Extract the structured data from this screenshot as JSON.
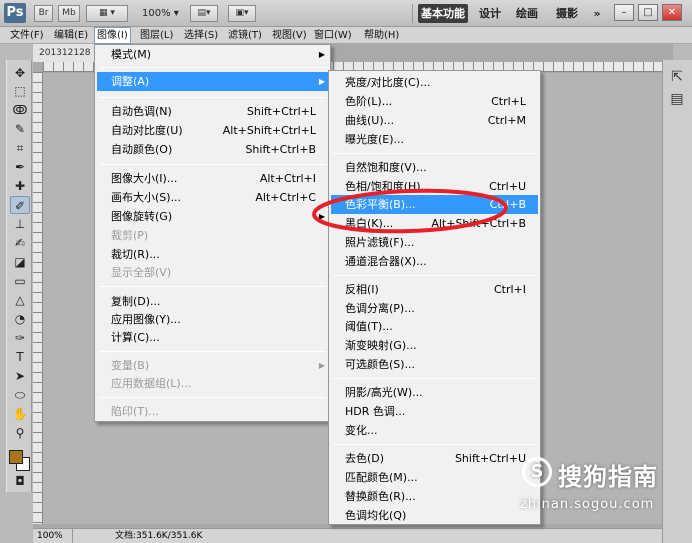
{
  "titlebar": {
    "logo": "Ps",
    "btn_br": "Br",
    "btn_mb": "Mb",
    "zoom": "100%",
    "workspaces": [
      "基本功能",
      "设计",
      "绘画",
      "摄影"
    ],
    "more": "»"
  },
  "menubar": [
    "文件(F)",
    "编辑(E)",
    "图像(I)",
    "图层(L)",
    "选择(S)",
    "滤镜(T)",
    "视图(V)",
    "窗口(W)",
    "帮助(H)"
  ],
  "document": {
    "tab": "201312128"
  },
  "image_menu": [
    {
      "label": "模式(M)",
      "shortcut": "",
      "arrow": "▶",
      "disabled": false
    },
    {
      "label": "调整(A)",
      "shortcut": "",
      "arrow": "▶",
      "disabled": false
    },
    {
      "label": "自动色调(N)",
      "shortcut": "Shift+Ctrl+L",
      "disabled": false
    },
    {
      "label": "自动对比度(U)",
      "shortcut": "Alt+Shift+Ctrl+L",
      "disabled": false
    },
    {
      "label": "自动颜色(O)",
      "shortcut": "Shift+Ctrl+B",
      "disabled": false
    },
    {
      "label": "图像大小(I)...",
      "shortcut": "Alt+Ctrl+I",
      "disabled": false
    },
    {
      "label": "画布大小(S)...",
      "shortcut": "Alt+Ctrl+C",
      "disabled": false
    },
    {
      "label": "图像旋转(G)",
      "shortcut": "",
      "arrow": "▶",
      "disabled": false
    },
    {
      "label": "裁剪(P)",
      "shortcut": "",
      "disabled": true
    },
    {
      "label": "裁切(R)...",
      "shortcut": "",
      "disabled": false
    },
    {
      "label": "显示全部(V)",
      "shortcut": "",
      "disabled": true
    },
    {
      "label": "复制(D)...",
      "shortcut": "",
      "disabled": false
    },
    {
      "label": "应用图像(Y)...",
      "shortcut": "",
      "disabled": false
    },
    {
      "label": "计算(C)...",
      "shortcut": "",
      "disabled": false
    },
    {
      "label": "变量(B)",
      "shortcut": "",
      "arrow": "▶",
      "disabled": true
    },
    {
      "label": "应用数据组(L)...",
      "shortcut": "",
      "disabled": true
    },
    {
      "label": "陷印(T)...",
      "shortcut": "",
      "disabled": true
    }
  ],
  "adjust_menu": [
    {
      "label": "亮度/对比度(C)...",
      "shortcut": ""
    },
    {
      "label": "色阶(L)...",
      "shortcut": "Ctrl+L"
    },
    {
      "label": "曲线(U)...",
      "shortcut": "Ctrl+M"
    },
    {
      "label": "曝光度(E)...",
      "shortcut": ""
    },
    {
      "label": "自然饱和度(V)...",
      "shortcut": ""
    },
    {
      "label": "色相/饱和度(H)...",
      "shortcut": "Ctrl+U"
    },
    {
      "label": "色彩平衡(B)...",
      "shortcut": "Ctrl+B"
    },
    {
      "label": "黑白(K)...",
      "shortcut": "Alt+Shift+Ctrl+B"
    },
    {
      "label": "照片滤镜(F)...",
      "shortcut": ""
    },
    {
      "label": "通道混合器(X)...",
      "shortcut": ""
    },
    {
      "label": "反相(I)",
      "shortcut": "Ctrl+I"
    },
    {
      "label": "色调分离(P)...",
      "shortcut": ""
    },
    {
      "label": "阈值(T)...",
      "shortcut": ""
    },
    {
      "label": "渐变映射(G)...",
      "shortcut": ""
    },
    {
      "label": "可选颜色(S)...",
      "shortcut": ""
    },
    {
      "label": "阴影/高光(W)...",
      "shortcut": ""
    },
    {
      "label": "HDR 色调...",
      "shortcut": ""
    },
    {
      "label": "变化...",
      "shortcut": ""
    },
    {
      "label": "去色(D)",
      "shortcut": "Shift+Ctrl+U"
    },
    {
      "label": "匹配颜色(M)...",
      "shortcut": ""
    },
    {
      "label": "替换颜色(R)...",
      "shortcut": ""
    },
    {
      "label": "色调均化(Q)",
      "shortcut": ""
    }
  ],
  "status": {
    "zoom": "100%",
    "doc": "文档:351.6K/351.6K"
  },
  "watermark": {
    "symbol": "S",
    "text": "搜狗指南",
    "url": "zhinan.sogou.com"
  },
  "colors": {
    "highlight": "#3399ff",
    "annotation": "#e8202a",
    "foreground": "#a8741c"
  }
}
